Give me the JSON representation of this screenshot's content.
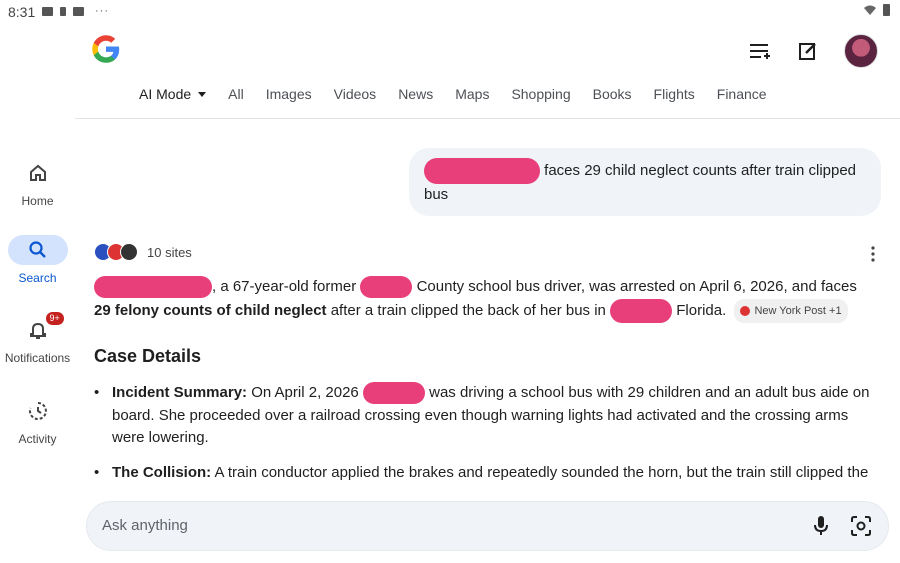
{
  "status_bar": {
    "time": "8:31",
    "dots": "···"
  },
  "header": {
    "logo": "google-g-logo",
    "icons": [
      "history-list-icon",
      "new-chat-icon",
      "avatar"
    ]
  },
  "tabs": [
    {
      "label": "AI Mode",
      "active": true
    },
    {
      "label": "All"
    },
    {
      "label": "Images"
    },
    {
      "label": "Videos"
    },
    {
      "label": "News"
    },
    {
      "label": "Maps"
    },
    {
      "label": "Shopping"
    },
    {
      "label": "Books"
    },
    {
      "label": "Flights"
    },
    {
      "label": "Finance"
    }
  ],
  "sidebar": {
    "items": [
      {
        "label": "Home",
        "icon": "home-icon"
      },
      {
        "label": "Search",
        "icon": "search-icon",
        "active": true
      },
      {
        "label": "Notifications",
        "icon": "bell-icon",
        "badge": "9+"
      },
      {
        "label": "Activity",
        "icon": "activity-icon"
      }
    ]
  },
  "query": {
    "text_part1": "faces 29 child neglect counts after train clipped",
    "text_part2": "bus"
  },
  "sources": {
    "count_label": "10 sites"
  },
  "answer": {
    "p1": ", a 67-year-old former",
    "p2": "County school bus driver, was arrested on April 6, 2026, and faces",
    "p3_bold": "29 felony counts of child neglect",
    "p4": "after a train clipped the back of her bus in",
    "p5": "Florida.",
    "chip": "New York Post +1"
  },
  "case_details": {
    "heading": "Case Details",
    "bullet1_label": "Incident Summary:",
    "bullet1_text_a": "On April 2, 2026",
    "bullet1_text_b": "was driving a school bus with 29 children and an adult bus aide on board. She proceeded over a railroad crossing even though warning lights had activated and the crossing arms were lowering.",
    "bullet2_label": "The Collision:",
    "bullet2_text": "A train conductor applied the brakes and repeatedly sounded the horn, but the train still clipped the"
  },
  "ask_bar": {
    "placeholder": "Ask anything"
  },
  "colors": {
    "accent": "#0b57d0",
    "redaction": "#e83e7a",
    "badge": "#c5221f"
  }
}
